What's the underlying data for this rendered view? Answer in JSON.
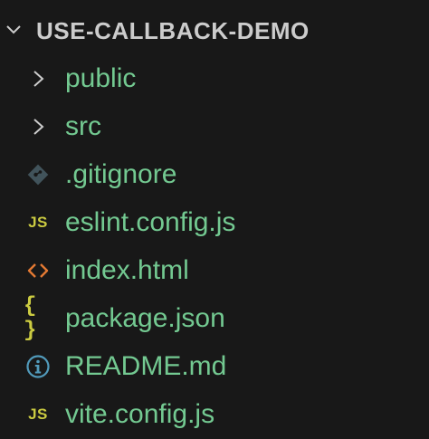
{
  "explorer": {
    "root": {
      "title": "USE-CALLBACK-DEMO",
      "icon": "chevron-down-icon",
      "expanded": true
    },
    "items": [
      {
        "label": "public",
        "kind": "folder",
        "icon": "chevron-right-icon",
        "expanded": false
      },
      {
        "label": "src",
        "kind": "folder",
        "icon": "chevron-right-icon",
        "expanded": false
      },
      {
        "label": ".gitignore",
        "kind": "file",
        "icon": "git-icon"
      },
      {
        "label": "eslint.config.js",
        "kind": "file",
        "icon": "javascript-icon",
        "icon_text": "JS"
      },
      {
        "label": "index.html",
        "kind": "file",
        "icon": "html-icon"
      },
      {
        "label": "package.json",
        "kind": "file",
        "icon": "json-icon",
        "icon_text": "{ }"
      },
      {
        "label": "README.md",
        "kind": "file",
        "icon": "info-icon"
      },
      {
        "label": "vite.config.js",
        "kind": "file",
        "icon": "javascript-icon",
        "icon_text": "JS"
      }
    ]
  },
  "colors": {
    "background": "#181818",
    "root_text": "#cccccc",
    "item_text": "#73c991",
    "chevron": "#cccccc",
    "js_icon": "#cbcb41",
    "json_icon": "#cbcb41",
    "html_icon": "#e37933",
    "git_icon": "#41535b",
    "info_icon": "#519aba"
  }
}
